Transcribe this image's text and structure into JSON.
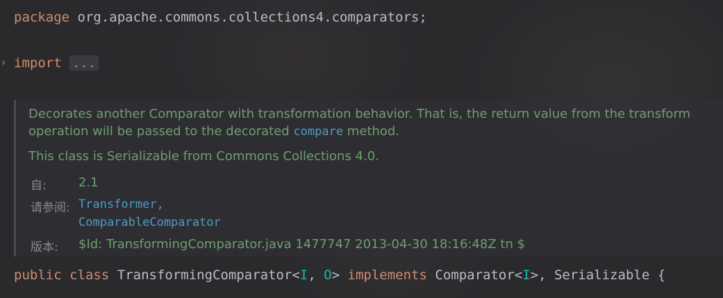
{
  "editor": {
    "line_package": {
      "keyword": "package",
      "name": " org.apache.commons.collections4.comparators;"
    },
    "line_import": {
      "keyword": "import",
      "folded": "..."
    },
    "doc": {
      "para1_part1": "Decorates another Comparator with transformation behavior. That is, the return value from the transform operation will be passed to the decorated ",
      "para1_code": "compare",
      "para1_part2": " method.",
      "para2": "This class is Serializable from Commons Collections 4.0.",
      "since_label": "自:",
      "since_value": "2.1",
      "see_label": "请参阅:",
      "see_link1": "Transformer",
      "see_sep": ",",
      "see_link2": "ComparableComparator",
      "version_label": "版本:",
      "version_value": "$Id: TransformingComparator.java 1477747 2013-04-30 18:16:48Z tn $"
    },
    "line_class": {
      "kw_public": "public",
      "kw_class": "class",
      "class_name": "TransformingComparator<",
      "tp_i": "I",
      "comma1": ", ",
      "tp_o": "O",
      "close1": "> ",
      "kw_implements": "implements",
      "iface": " Comparator<",
      "tp_i2": "I",
      "rest": ">, Serializable {"
    }
  }
}
